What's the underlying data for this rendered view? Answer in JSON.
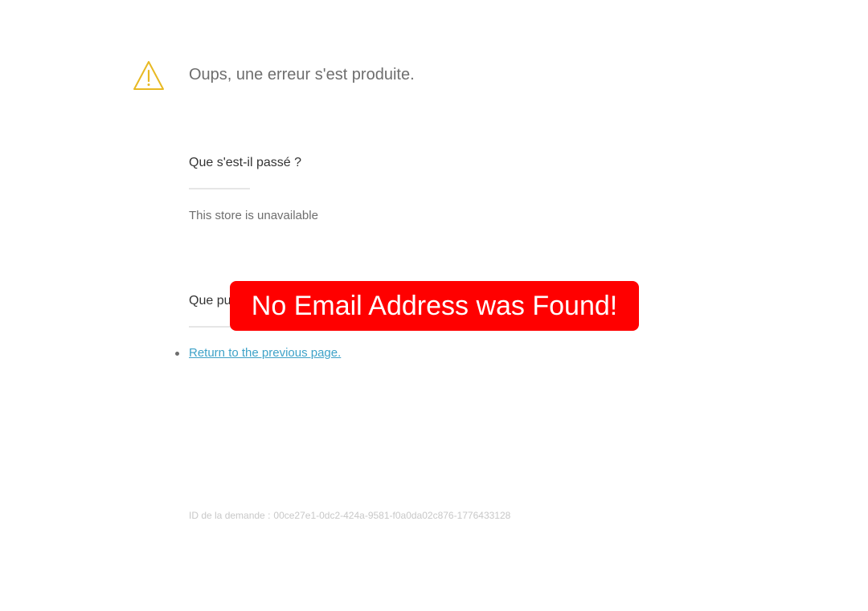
{
  "header": {
    "title": "Oups, une erreur s'est produite.",
    "icon": "warning-icon",
    "icon_color": "#e8b923"
  },
  "sections": {
    "what_happened": {
      "heading": "Que s'est-il passé ?",
      "text": "This store is unavailable"
    },
    "what_to_do": {
      "heading": "Que pu"
    }
  },
  "actions": {
    "return_link": "Return to the previous page."
  },
  "footer": {
    "request_id_label": "ID de la demande :",
    "request_id_value": "00ce27e1-0dc2-424a-9581-f0a0da02c876-1776433128"
  },
  "overlay": {
    "message": "No Email Address was Found!",
    "background": "#ff0000"
  },
  "colors": {
    "link": "#3ea2c8",
    "muted_text": "#6e6e6e",
    "faint_text": "#c8c8c8"
  }
}
